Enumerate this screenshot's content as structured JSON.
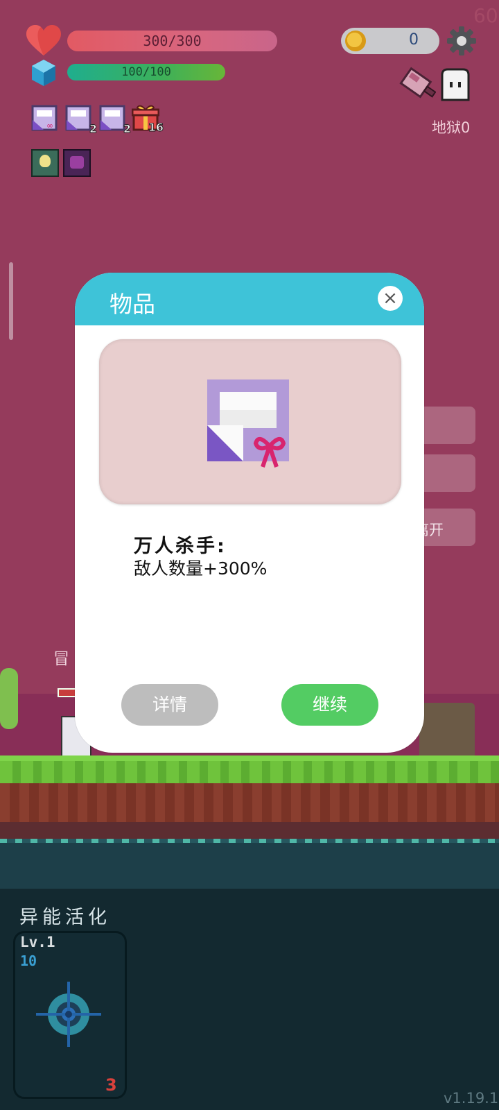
{
  "fps": "60",
  "stats": {
    "hp": "300/300",
    "mp": "100/100",
    "coins": "0"
  },
  "header": {
    "hell_level": "地狱0"
  },
  "items": [
    {
      "name": "scroll-item",
      "count": ""
    },
    {
      "name": "scroll-item",
      "count": "2"
    },
    {
      "name": "scroll-item",
      "count": "2"
    },
    {
      "name": "gift-item",
      "count": "16"
    }
  ],
  "background": {
    "side_leave_label": "离开",
    "adventurer_label": "冒"
  },
  "modal": {
    "title": "物品",
    "close_icon": "×",
    "item_name": "万人杀手:",
    "item_desc": "敌人数量+300%",
    "details_button": "详情",
    "continue_button": "继续"
  },
  "skill_panel": {
    "title": "异能活化",
    "level": "Lv.1",
    "cost": "10",
    "count": "3",
    "icon": "crosshair-icon"
  },
  "version": "v1.19.1",
  "colors": {
    "background": "#953b5c",
    "modal_header": "#3ec3d8",
    "continue_button": "#53cc63",
    "details_button": "#bdbdbd"
  }
}
